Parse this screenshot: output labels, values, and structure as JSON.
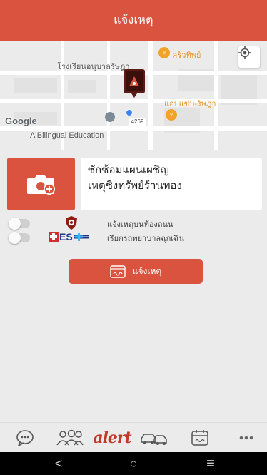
{
  "header": {
    "title": "แจ้งเหตุ"
  },
  "map": {
    "labels": {
      "school": "โรงเรียนอนุบาลรัษฎา",
      "restaurant1": "ครัวทิพย์",
      "restaurant2": "แอบแซ่บ-รัษฎา",
      "bilingual": "A Bilingual Education"
    },
    "road_number": "4269",
    "google_logo": "Google",
    "marker_color": "#5a1a16",
    "location_dot_color": "#3b82f6",
    "poi_color": "#f0a328"
  },
  "incident": {
    "line1": "ซักซ้อมแผนเผชิญ",
    "line2": "เหตุชิงทรัพย์ร้านทอง"
  },
  "toggles": [
    {
      "label": "แจ้งเหตุบนท้องถนน",
      "on": false,
      "icon": "police-shield-icon"
    },
    {
      "label": "เรียกรถพยาบาลฉุกเฉิน",
      "on": false,
      "icon": "ems-logo-icon"
    }
  ],
  "ems_text": "ES",
  "report_button": {
    "label": "แจ้งเหตุ"
  },
  "bottom_nav": {
    "items": [
      "chat-icon",
      "people-icon",
      "alert-logo-icon",
      "car-crash-icon",
      "calendar-icon",
      "more-icon"
    ],
    "alert_logo_text": "alert"
  },
  "system_bar": {
    "back": "<",
    "home": "○",
    "recents": "≡"
  },
  "colors": {
    "accent": "#d9533f",
    "background": "#ebebeb"
  }
}
